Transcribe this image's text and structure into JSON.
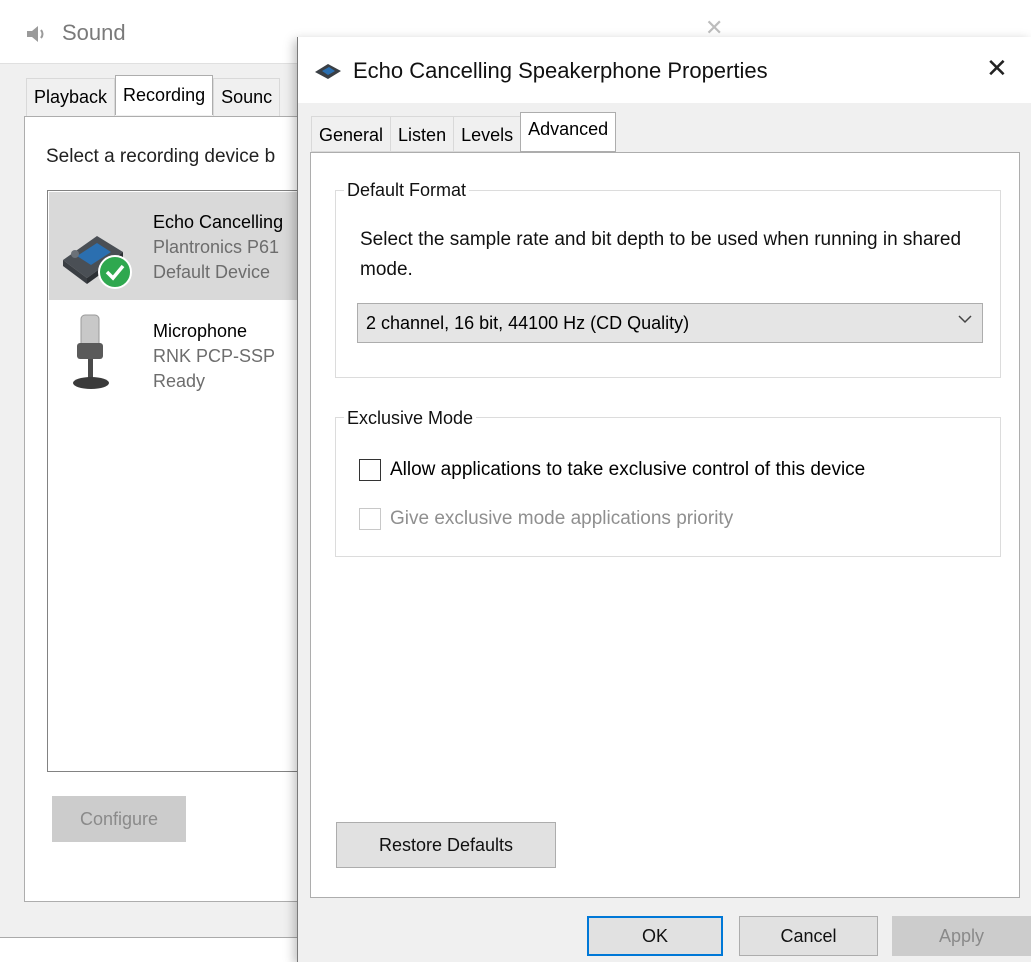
{
  "sound_window": {
    "title": "Sound",
    "close": "✕",
    "tabs": [
      {
        "label": "Playback"
      },
      {
        "label": "Recording"
      },
      {
        "label": "Sounc"
      }
    ],
    "instruction": "Select a recording device b",
    "devices": [
      {
        "name": "Echo Cancelling",
        "model": "Plantronics P61",
        "status": "Default Device"
      },
      {
        "name": "Microphone",
        "model": "RNK PCP-SSP",
        "status": "Ready"
      }
    ],
    "configure_label": "Configure"
  },
  "dialog": {
    "title": "Echo Cancelling Speakerphone Properties",
    "close": "✕",
    "tabs": [
      {
        "label": "General"
      },
      {
        "label": "Listen"
      },
      {
        "label": "Levels"
      },
      {
        "label": "Advanced"
      }
    ],
    "default_format": {
      "label": "Default Format",
      "description": "Select the sample rate and bit depth to be used when running in shared mode.",
      "selected_format": "2 channel, 16 bit, 44100 Hz (CD Quality)"
    },
    "exclusive_mode": {
      "label": "Exclusive Mode",
      "allow_label": "Allow applications to take exclusive control of this device",
      "priority_label": "Give exclusive mode applications priority"
    },
    "restore_label": "Restore Defaults",
    "ok_label": "OK",
    "cancel_label": "Cancel",
    "apply_label": "Apply"
  },
  "colors": {
    "accent": "#0078d7",
    "check_green": "#2fa84f"
  }
}
